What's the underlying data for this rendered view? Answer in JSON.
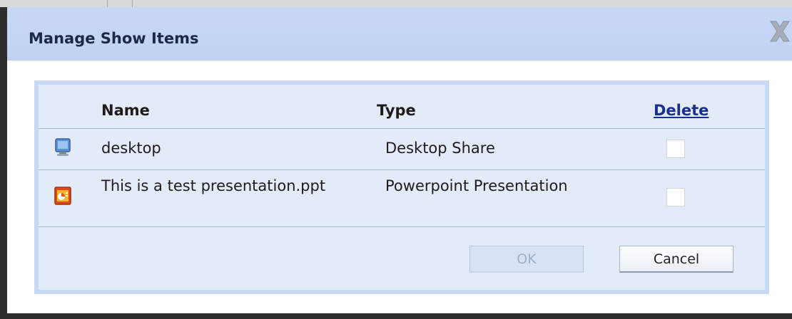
{
  "dialog": {
    "title": "Manage Show Items"
  },
  "table": {
    "headers": {
      "name": "Name",
      "type": "Type",
      "delete": "Delete"
    },
    "rows": [
      {
        "name": "desktop",
        "type": "Desktop Share",
        "icon": "monitor-icon",
        "delete_checked": false
      },
      {
        "name": "This is a test presentation.ppt",
        "type": "Powerpoint Presentation",
        "icon": "powerpoint-icon",
        "delete_checked": false
      }
    ]
  },
  "buttons": {
    "ok_label": "OK",
    "ok_enabled": false,
    "cancel_label": "Cancel"
  },
  "colors": {
    "titlebar": "#c7d8f4",
    "panel": "#e4ebf8",
    "delete_link": "#1a2f8f"
  }
}
